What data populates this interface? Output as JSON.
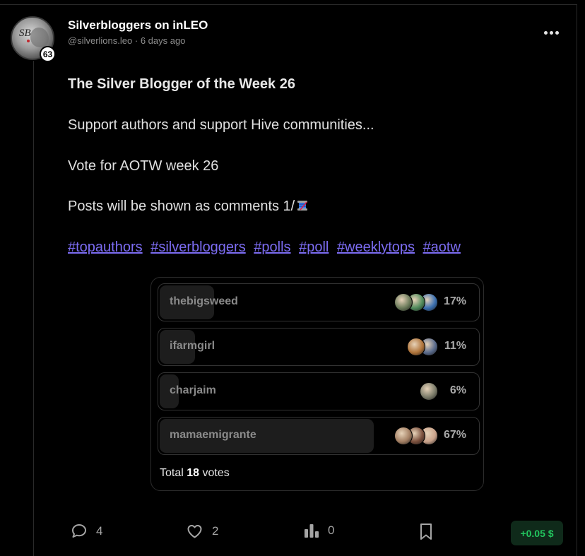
{
  "post": {
    "author_name": "Silverbloggers on inLEO",
    "handle": "@silverlions.leo",
    "time_ago": "6 days ago",
    "reputation": "63",
    "avatar_monogram": "SB",
    "title": "The Silver Blogger of the Week 26",
    "lines": [
      "Support authors and support Hive communities...",
      "Vote for AOTW week 26",
      "Posts will be shown as comments 1/"
    ],
    "emoji_icon": "thread-spool-icon",
    "tags": [
      "#topauthors",
      "#silverbloggers",
      "#polls",
      "#poll",
      "#weeklytops",
      "#aotw"
    ]
  },
  "poll": {
    "options": [
      {
        "label": "thebigsweed",
        "percent": "17%",
        "share": 0.17,
        "voter_colors": [
          "#6b7b5a",
          "#4f8a5b",
          "#3a6fb0"
        ]
      },
      {
        "label": "ifarmgirl",
        "percent": "11%",
        "share": 0.11,
        "voter_colors": [
          "#b0743a",
          "#5a6b8c"
        ]
      },
      {
        "label": "charjaim",
        "percent": "6%",
        "share": 0.06,
        "voter_colors": [
          "#7c7c6a"
        ]
      },
      {
        "label": "mamaemigrante",
        "percent": "67%",
        "share": 0.67,
        "voter_colors": [
          "#a37f63",
          "#7a4f3c",
          "#c9a28a"
        ]
      }
    ],
    "total_prefix": "Total",
    "total_votes": "18",
    "total_suffix": "votes"
  },
  "actions": {
    "comments_count": "4",
    "likes_count": "2",
    "views_count": "0",
    "earnings": "+0.05 $"
  },
  "colors": {
    "tag_link": "#7c6cf2",
    "earnings_text": "#22c55e",
    "earnings_bg": "#0f2a1a",
    "background": "#000000"
  }
}
